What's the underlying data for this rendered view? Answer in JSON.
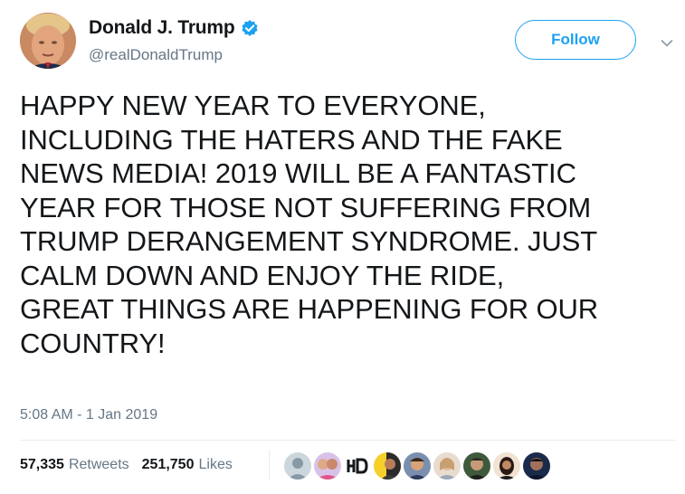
{
  "author": {
    "display_name": "Donald J. Trump",
    "handle": "@realDonaldTrump",
    "verified": true
  },
  "follow_button": {
    "label": "Follow"
  },
  "tweet": {
    "text_lines": [
      "HAPPY NEW YEAR TO EVERYONE,",
      "INCLUDING THE HATERS AND THE FAKE",
      "NEWS MEDIA! 2019 WILL BE A FANTASTIC",
      "YEAR FOR THOSE NOT SUFFERING FROM",
      "TRUMP DERANGEMENT SYNDROME. JUST",
      "CALM DOWN AND ENJOY THE RIDE,",
      "GREAT THINGS ARE HAPPENING FOR OUR",
      "COUNTRY!"
    ],
    "timestamp": "5:08 AM - 1 Jan 2019"
  },
  "stats": {
    "retweets_count": "57,335",
    "retweets_label": "Retweets",
    "likes_count": "251,750",
    "likes_label": "Likes"
  },
  "colors": {
    "accent": "#1da1f2",
    "text": "#14171a",
    "muted": "#657786",
    "divider": "#e6ecf0"
  },
  "icons": {
    "verified": "verified-badge-icon",
    "caret": "chevron-down-icon"
  }
}
